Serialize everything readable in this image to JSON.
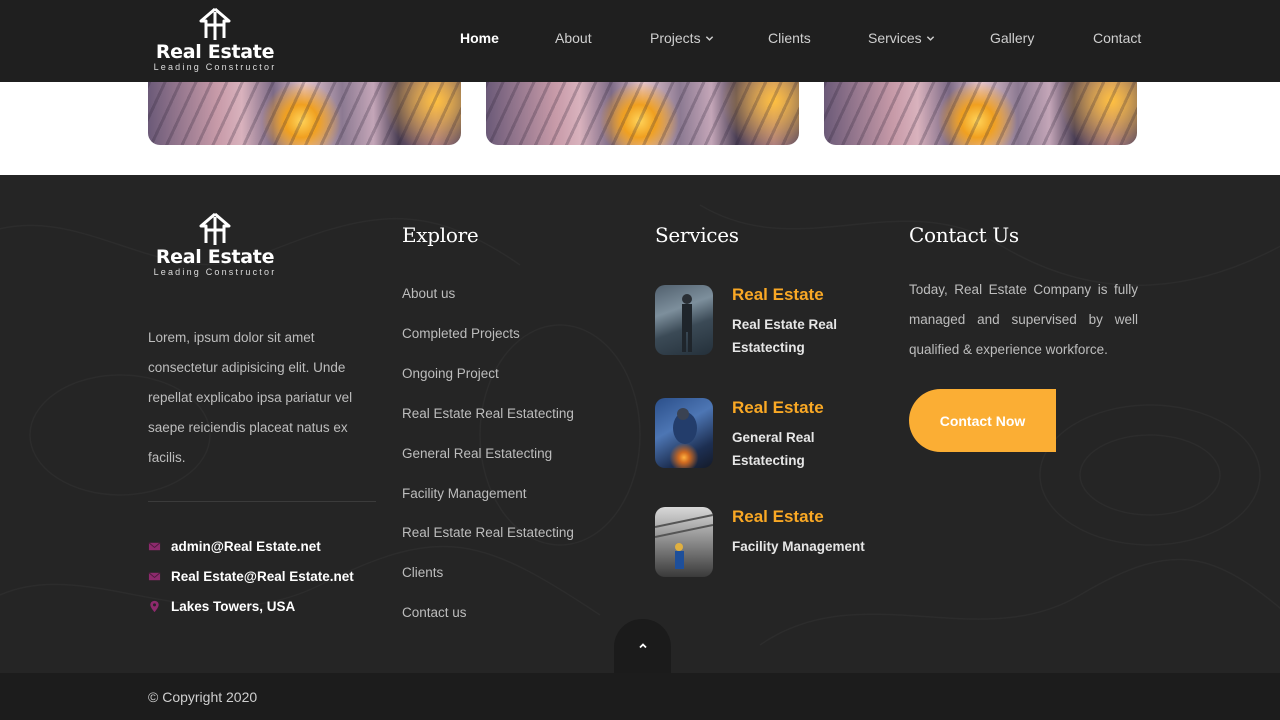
{
  "header": {
    "logo": {
      "name": "Real Estate",
      "tagline": "Leading Constructor"
    },
    "nav": [
      {
        "label": "Home",
        "active": true,
        "dropdown": false
      },
      {
        "label": "About",
        "active": false,
        "dropdown": false
      },
      {
        "label": "Projects",
        "active": false,
        "dropdown": true
      },
      {
        "label": "Clients",
        "active": false,
        "dropdown": false
      },
      {
        "label": "Services",
        "active": false,
        "dropdown": true
      },
      {
        "label": "Gallery",
        "active": false,
        "dropdown": false
      },
      {
        "label": "Contact",
        "active": false,
        "dropdown": false
      }
    ]
  },
  "footer": {
    "logo": {
      "name": "Real Estate",
      "tagline": "Leading Constructor"
    },
    "about_text": "Lorem, ipsum dolor sit amet consectetur adipisicing elit. Unde repellat explicabo ipsa pariatur vel saepe reiciendis placeat natus ex facilis.",
    "contacts": [
      {
        "icon": "envelope-icon",
        "text": "admin@Real Estate.net"
      },
      {
        "icon": "envelope-icon",
        "text": "Real Estate@Real Estate.net"
      },
      {
        "icon": "location-pin-icon",
        "text": "Lakes Towers, USA"
      }
    ],
    "explore": {
      "title": "Explore",
      "links": [
        "About us",
        "Completed Projects",
        "Ongoing Project",
        "Real Estate Real Estatecting",
        "General Real Estatecting",
        "Facility Management",
        "Real Estate Real Estatecting",
        "Clients",
        "Contact us"
      ]
    },
    "services": {
      "title": "Services",
      "items": [
        {
          "title": "Real Estate",
          "subtitle": "Real Estate Real Estatecting"
        },
        {
          "title": "Real Estate",
          "subtitle": "General Real Estatecting"
        },
        {
          "title": "Real Estate",
          "subtitle": "Facility Management"
        }
      ]
    },
    "contact_us": {
      "title": "Contact Us",
      "text": "Today, Real Estate Company is fully managed and supervised by well qualified & experience workforce.",
      "button": "Contact Now"
    },
    "copyright": "© Copyright 2020"
  },
  "colors": {
    "accent": "#fbae34",
    "service_title": "#f9a825",
    "contact_icon": "#8e2a6d"
  }
}
